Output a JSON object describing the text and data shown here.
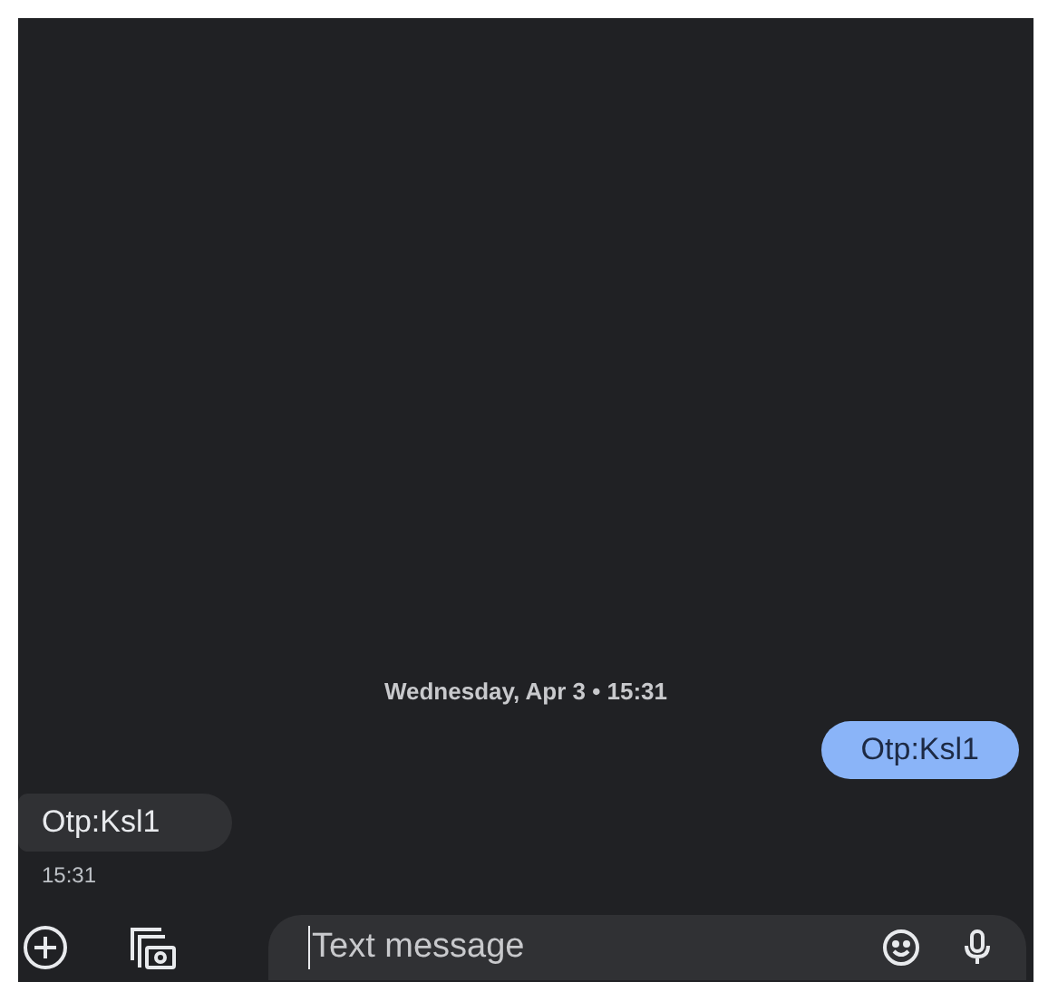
{
  "date_header": "Wednesday, Apr 3 • 15:31",
  "messages": [
    {
      "text": "Otp:Ksl1",
      "kind": "outgoing"
    },
    {
      "text": "Otp:Ksl1",
      "kind": "incoming",
      "time": "15:31"
    }
  ],
  "composer": {
    "placeholder": "Text message"
  }
}
